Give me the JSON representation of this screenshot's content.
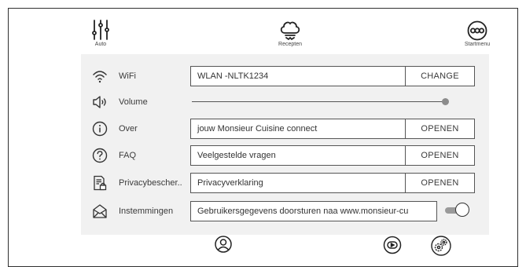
{
  "header": {
    "auto": {
      "label": "Auto",
      "icon": "sliders-icon"
    },
    "recipes": {
      "label": "Recepten",
      "icon": "chef-hat-icon"
    },
    "start_menu": {
      "label": "Startmenu",
      "icon": "start-menu-icon"
    }
  },
  "settings": {
    "wifi": {
      "label": "WiFi",
      "value": "WLAN -NLTK1234",
      "button": "CHANGE",
      "icon": "wifi-icon"
    },
    "volume": {
      "label": "Volume",
      "level": 0.98,
      "icon": "speaker-icon"
    },
    "about": {
      "label": "Over",
      "value": "jouw Monsieur Cuisine connect",
      "button": "OPENEN",
      "icon": "info-icon"
    },
    "faq": {
      "label": "FAQ",
      "value": "Veelgestelde vragen",
      "button": "OPENEN",
      "icon": "question-icon"
    },
    "privacy": {
      "label": "Privacybescher..",
      "value": "Privacyverklaring",
      "button": "OPENEN",
      "icon": "privacy-document-icon"
    },
    "consent": {
      "label": "Instemmingen",
      "value": "Gebruikersgegevens doorsturen naa www.monsieur-cu",
      "toggle_on": true,
      "icon": "envelope-icon"
    }
  },
  "footer": {
    "icons": [
      "user-icon",
      "play-icon",
      "settings-gears-icon"
    ]
  },
  "colors": {
    "panel": "#f1f1f1",
    "border": "#555555",
    "text": "#3a3a3a"
  }
}
